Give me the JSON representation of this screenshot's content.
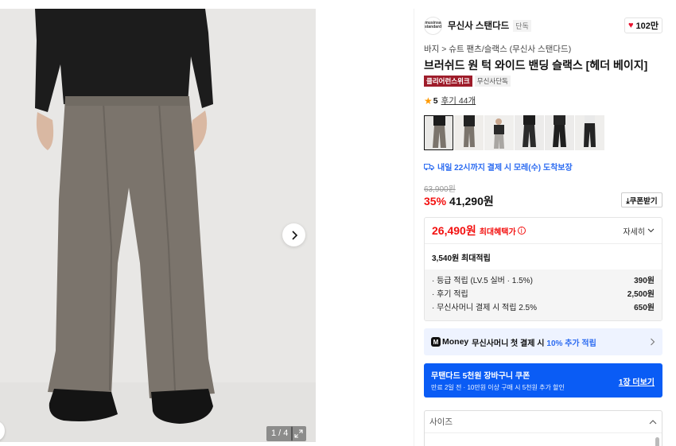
{
  "gallery": {
    "counter": "1 / 4"
  },
  "brand": {
    "logo_text": "musinsa standard",
    "name": "무신사 스탠다드",
    "badge": "단독",
    "likes": "102만"
  },
  "product": {
    "breadcrumb": "바지 > 슈트 팬츠/슬랙스 (무신사 스탠다드)",
    "title": "브러쉬드 원 턱 와이드 밴딩 슬랙스 [헤더 베이지]",
    "tags": [
      "클리어런스위크",
      "무신사단독"
    ],
    "rating": "5",
    "reviews": "후기 44개"
  },
  "delivery": {
    "text": "내일 22시까지 결제 시 모레(수) 도착보장"
  },
  "price": {
    "original": "63,900원",
    "discount": "35%",
    "sale": "41,290원",
    "coupon_button": "⤓쿠폰받기"
  },
  "benefit": {
    "max_price": "26,490원",
    "max_label": "최대혜택가",
    "info_icon": "i",
    "detail": "자세히",
    "points_total": "3,540원 최대적립",
    "points": [
      {
        "label": "· 등급 적립 (LV.5 실버 · 1.5%)",
        "value": "390원"
      },
      {
        "label": "· 후기 적립",
        "value": "2,500원"
      },
      {
        "label": "· 무신사머니 결제 시 적립 2.5%",
        "value": "650원"
      }
    ]
  },
  "money_banner": {
    "logo": "M",
    "brand": "Money",
    "text": "무신사머니 첫 결제 시",
    "highlight": "10% 추가 적립"
  },
  "coupon_banner": {
    "title": "무탠다드 5천원 장바구니 쿠폰",
    "subtitle": "만료 2일 전 · 10만원 이상 구매 시 5천원 추가 할인",
    "action": "1장 더보기"
  },
  "size": {
    "label": "사이즈"
  },
  "colors": {
    "accent_red": "#f31110",
    "accent_blue": "#2b6bf1",
    "coupon_blue": "#0a5cf5",
    "tag_red": "#9e1c2a"
  }
}
